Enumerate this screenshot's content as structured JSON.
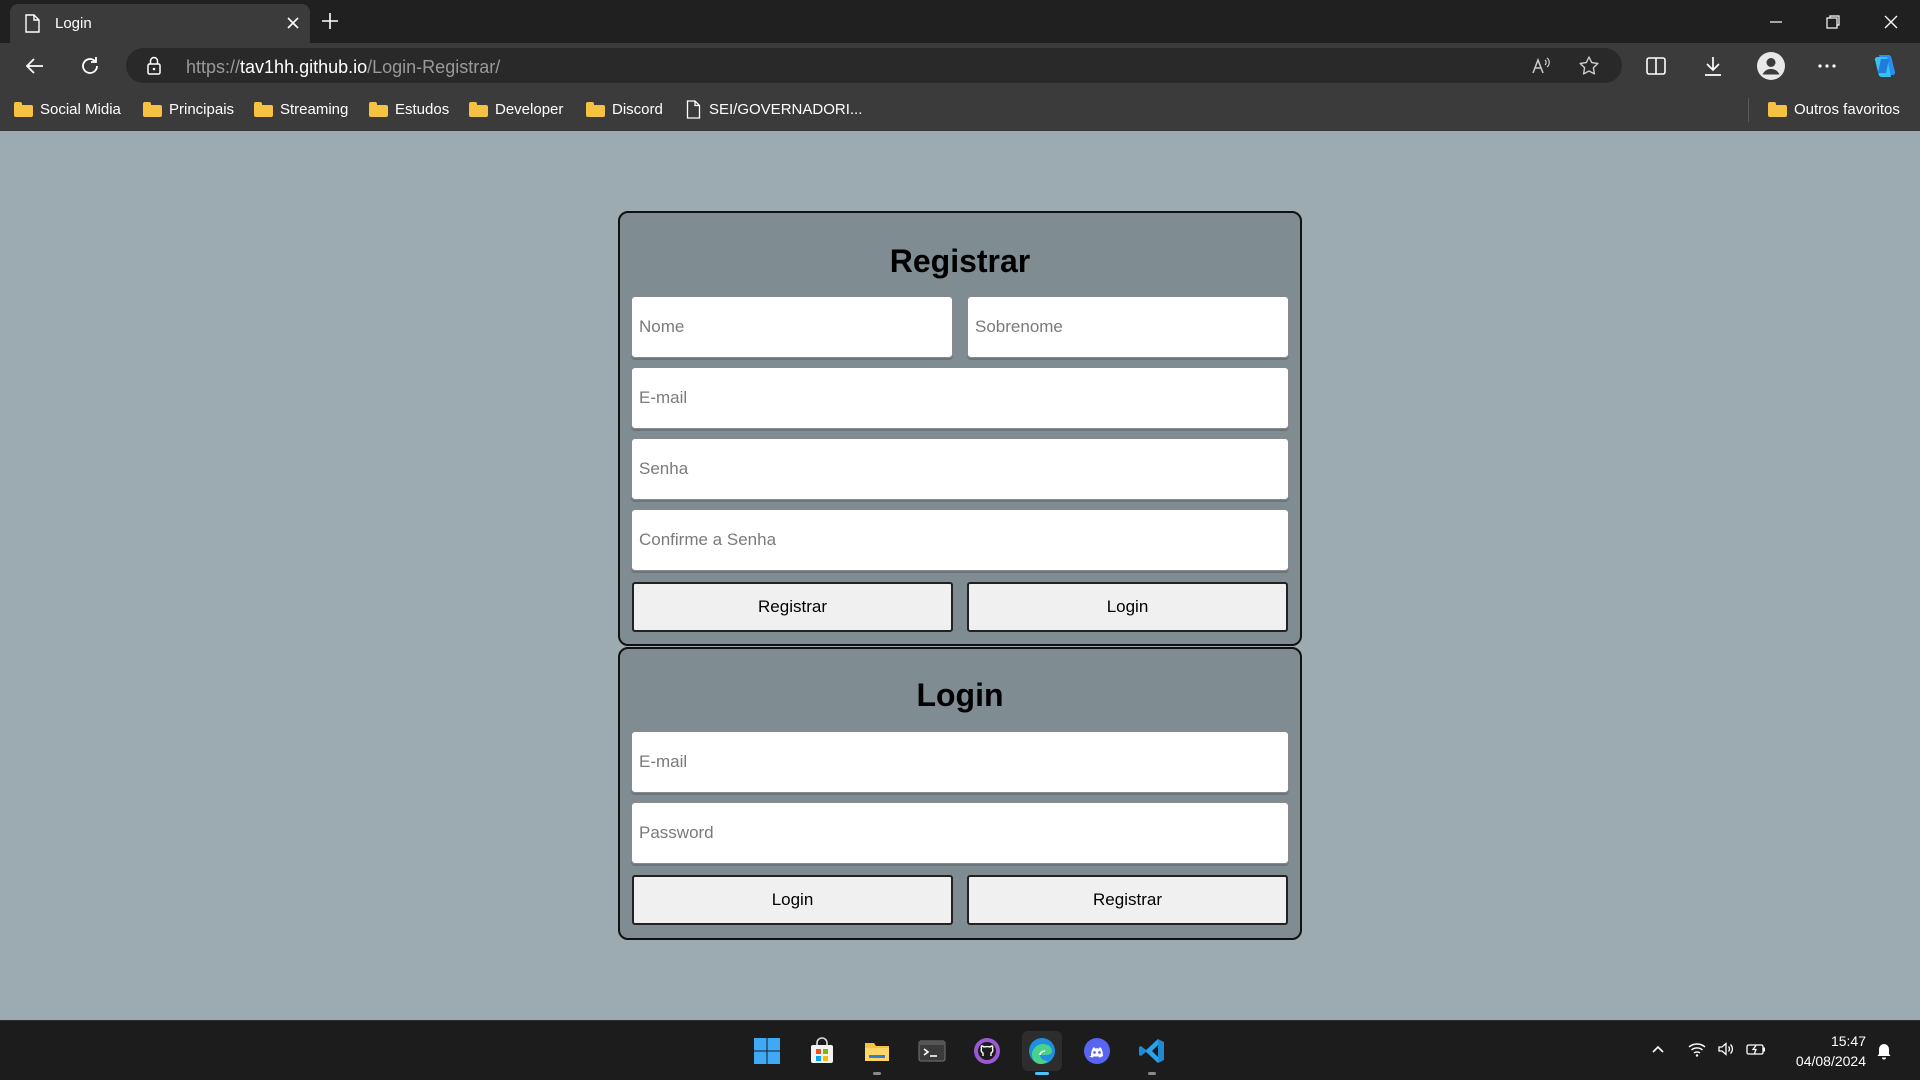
{
  "browser": {
    "tab": {
      "title": "Login"
    },
    "address": {
      "scheme": "https://",
      "host": "tav1hh.github.io",
      "path": "/Login-Registrar/"
    },
    "bookmarks": [
      {
        "label": "Social Midia",
        "type": "folder"
      },
      {
        "label": "Principais",
        "type": "folder"
      },
      {
        "label": "Streaming",
        "type": "folder"
      },
      {
        "label": "Estudos",
        "type": "folder"
      },
      {
        "label": "Developer",
        "type": "folder"
      },
      {
        "label": "Discord",
        "type": "folder"
      },
      {
        "label": "SEI/GOVERNADORI...",
        "type": "page"
      }
    ],
    "other_favorites": "Outros favoritos"
  },
  "register": {
    "title": "Registrar",
    "name_placeholder": "Nome",
    "surname_placeholder": "Sobrenome",
    "email_placeholder": "E-mail",
    "password_placeholder": "Senha",
    "confirm_placeholder": "Confirme a Senha",
    "primary_button": "Registrar",
    "secondary_button": "Login"
  },
  "login": {
    "title": "Login",
    "email_placeholder": "E-mail",
    "password_placeholder": "Password",
    "primary_button": "Login",
    "secondary_button": "Registrar"
  },
  "taskbar": {
    "apps": [
      "start-icon",
      "store-icon",
      "file-explorer-icon",
      "terminal-icon",
      "github-desktop-icon",
      "edge-icon",
      "discord-icon",
      "vscode-icon"
    ],
    "time": "15:47",
    "date": "04/08/2024"
  },
  "colors": {
    "page_background": "#9cabb2",
    "card_background": "#7f8c91",
    "chrome_dark": "#202020",
    "chrome_toolbar": "#3b3b3b",
    "taskbar": "#1c1c1c"
  }
}
